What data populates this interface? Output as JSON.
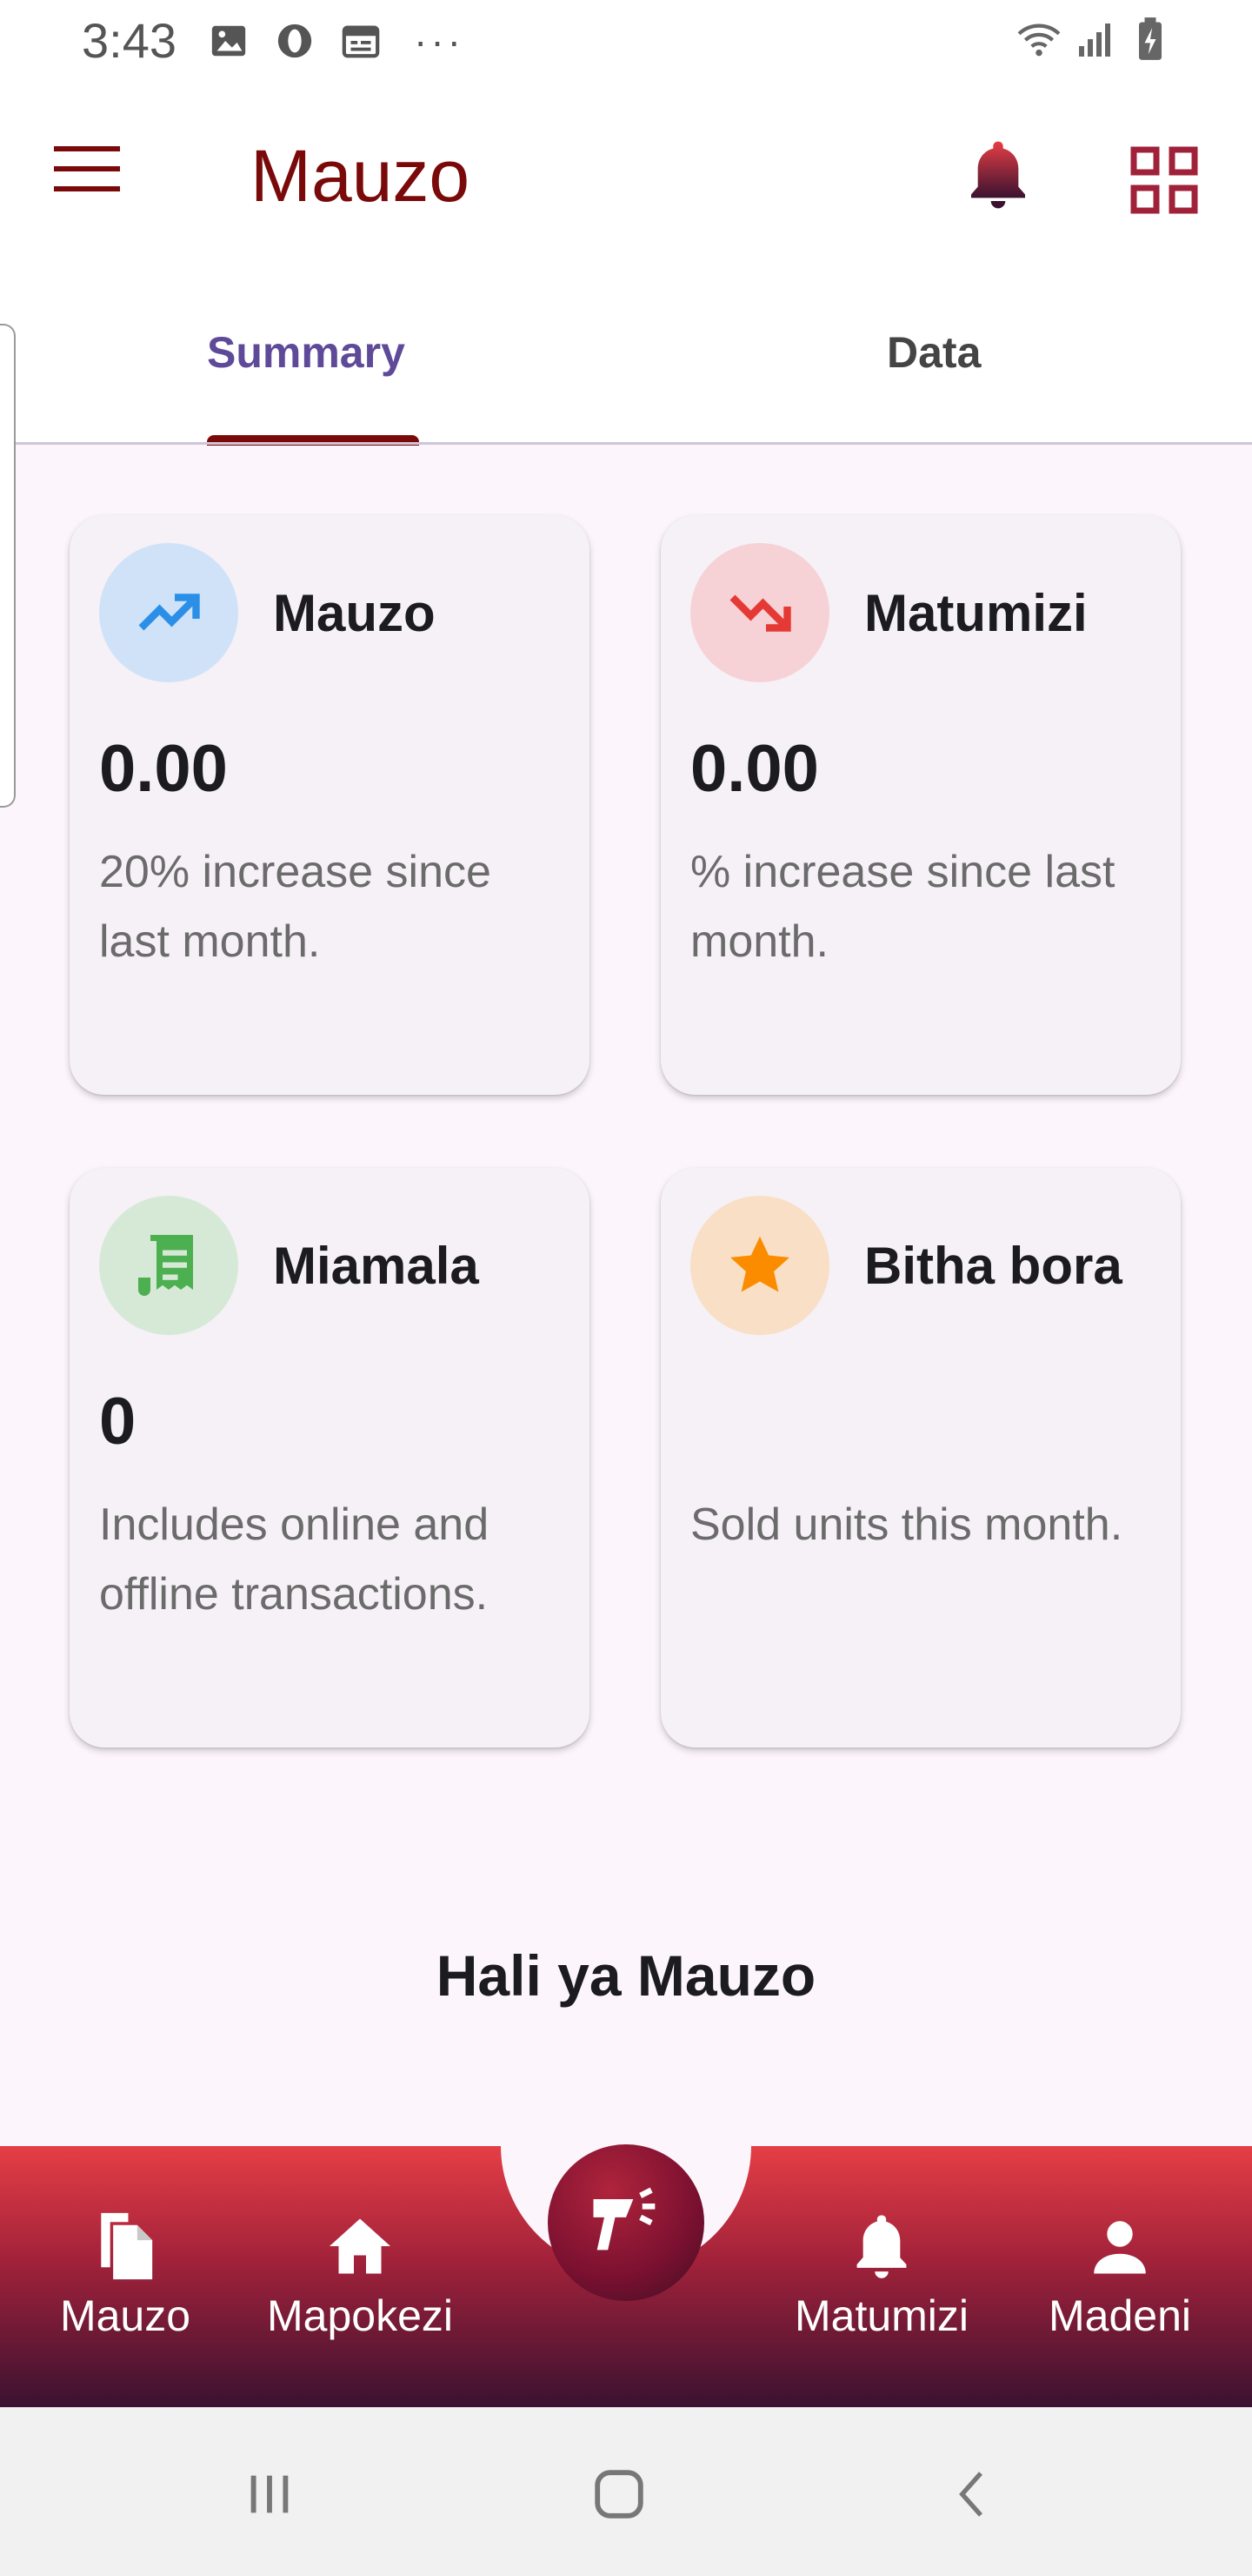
{
  "status_bar": {
    "time": "3:43",
    "left_icons": [
      "gallery-icon",
      "opera-icon",
      "calendar-icon"
    ],
    "more": "···",
    "right_icons": [
      "wifi-icon",
      "signal-icon",
      "battery-charging-icon"
    ]
  },
  "app_bar": {
    "title": "Mauzo",
    "menu_icon": "hamburger-menu-icon",
    "notifications_icon": "bell-icon",
    "apps_icon": "grid-icon"
  },
  "tabs": [
    {
      "label": "Summary",
      "selected": true
    },
    {
      "label": "Data",
      "selected": false
    }
  ],
  "cards": [
    {
      "title": "Mauzo",
      "value": "0.00",
      "description": "20% increase since last month.",
      "icon": "trending-up-icon",
      "icon_color": "#2b8fe8",
      "icon_bg": "#d0e2f8"
    },
    {
      "title": "Matumizi",
      "value": "0.00",
      "description": "% increase since last month.",
      "icon": "trending-down-icon",
      "icon_color": "#e53935",
      "icon_bg": "#f6d2d6"
    },
    {
      "title": "Miamala",
      "value": "0",
      "description": "Includes online and offline transactions.",
      "icon": "receipt-icon",
      "icon_color": "#4caf50",
      "icon_bg": "#d6e9d7"
    },
    {
      "title": "Bitha bora",
      "value": "",
      "description": "Sold  units this month.",
      "icon": "star-icon",
      "icon_color": "#fb8c00",
      "icon_bg": "#f8dfc6"
    }
  ],
  "section_title": "Hali ya Mauzo",
  "bottom_nav": {
    "items": [
      {
        "label": "Mauzo",
        "icon": "documents-icon"
      },
      {
        "label": "Mapokezi",
        "icon": "home-icon"
      },
      {
        "label": "Matumizi",
        "icon": "bell-icon"
      },
      {
        "label": "Madeni",
        "icon": "person-icon"
      }
    ],
    "fab_icon": "barcode-scanner-icon"
  },
  "colors": {
    "brand": "#7a0a0a",
    "tab_selected": "#5e4a99",
    "nav_gradient_top": "#e53e45",
    "nav_gradient_bottom": "#3a1230"
  }
}
